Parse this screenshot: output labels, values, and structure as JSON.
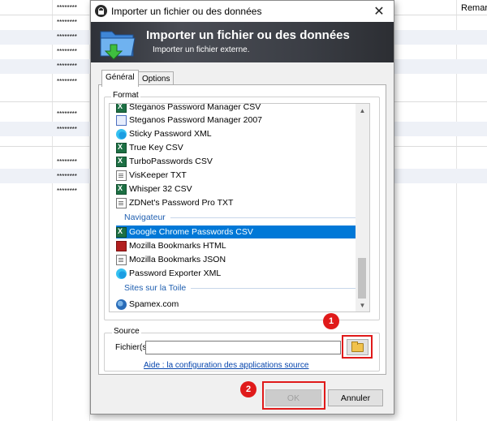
{
  "background": {
    "password_mask": "********",
    "column_header_right": "Remar"
  },
  "dialog": {
    "title": "Importer un fichier ou des données",
    "close_glyph": "✕",
    "banner_title": "Importer un fichier ou des données",
    "banner_subtitle": "Importer un fichier externe.",
    "tabs": [
      {
        "label": "Général",
        "active": true
      },
      {
        "label": "Options",
        "active": false
      }
    ],
    "format": {
      "label": "Format",
      "items": [
        {
          "kind": "item",
          "icon": "excel-icon",
          "label": "Steganos Password Manager CSV"
        },
        {
          "kind": "item",
          "icon": "steganos-icon",
          "label": "Steganos Password Manager 2007"
        },
        {
          "kind": "item",
          "icon": "edge-icon",
          "label": "Sticky Password XML"
        },
        {
          "kind": "item",
          "icon": "excel-icon",
          "label": "True Key CSV"
        },
        {
          "kind": "item",
          "icon": "excel-icon",
          "label": "TurboPasswords CSV"
        },
        {
          "kind": "item",
          "icon": "document-icon",
          "label": "VisKeeper TXT"
        },
        {
          "kind": "item",
          "icon": "excel-icon",
          "label": "Whisper 32 CSV"
        },
        {
          "kind": "item",
          "icon": "document-icon",
          "label": "ZDNet's Password Pro TXT"
        },
        {
          "kind": "category",
          "label": "Navigateur"
        },
        {
          "kind": "item",
          "icon": "excel-icon",
          "label": "Google Chrome Passwords CSV",
          "selected": true
        },
        {
          "kind": "item",
          "icon": "mozilla-icon",
          "label": "Mozilla Bookmarks HTML"
        },
        {
          "kind": "item",
          "icon": "document-icon",
          "label": "Mozilla Bookmarks JSON"
        },
        {
          "kind": "item",
          "icon": "edge-icon",
          "label": "Password Exporter XML"
        },
        {
          "kind": "category",
          "label": "Sites sur la Toile"
        },
        {
          "kind": "item",
          "icon": "globe-icon",
          "label": "Spamex.com"
        }
      ]
    },
    "source": {
      "label": "Source",
      "file_label": "Fichier(s)",
      "file_value": "",
      "help_link": "Aide : la configuration des applications source"
    },
    "buttons": {
      "ok": "OK",
      "cancel": "Annuler"
    }
  },
  "annotations": {
    "badge_1": "1",
    "badge_2": "2",
    "color": "#e01a1a"
  }
}
